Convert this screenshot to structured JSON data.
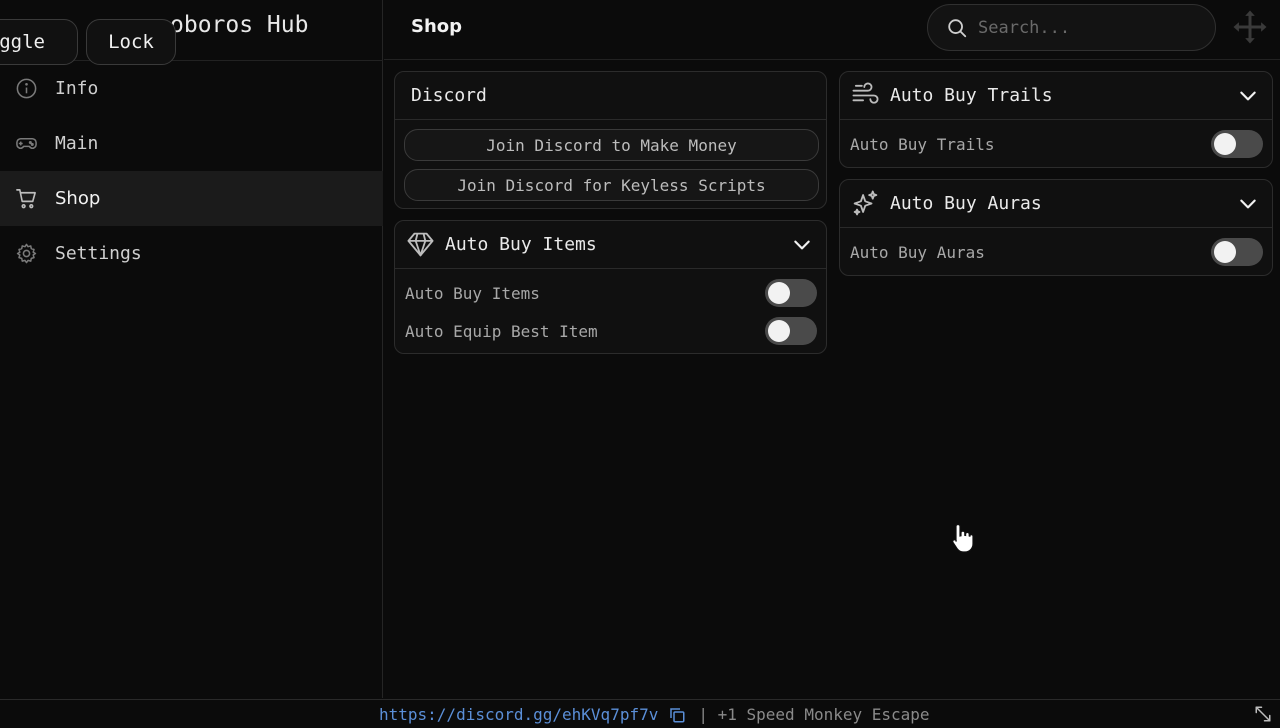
{
  "sidebar": {
    "hub_title": "oboros Hub",
    "toggle_label": "ggle",
    "lock_label": "Lock",
    "items": [
      {
        "label": "Info",
        "icon": "info-icon"
      },
      {
        "label": "Main",
        "icon": "gamepad-icon"
      },
      {
        "label": "Shop",
        "icon": "cart-icon",
        "active": true
      },
      {
        "label": "Settings",
        "icon": "gear-icon"
      }
    ]
  },
  "header": {
    "title": "Shop",
    "search_placeholder": "Search..."
  },
  "discord": {
    "title": "Discord",
    "button_money": "Join Discord to Make Money",
    "button_keyless": "Join Discord for Keyless Scripts"
  },
  "items": {
    "title": "Auto Buy Items",
    "toggles": [
      {
        "label": "Auto Buy Items",
        "on": false
      },
      {
        "label": "Auto Equip Best Item",
        "on": false
      }
    ]
  },
  "trails": {
    "title": "Auto Buy Trails",
    "toggles": [
      {
        "label": "Auto Buy Trails",
        "on": false
      }
    ]
  },
  "auras": {
    "title": "Auto Buy Auras",
    "toggles": [
      {
        "label": "Auto Buy Auras",
        "on": false
      }
    ]
  },
  "footer": {
    "link": "https://discord.gg/ehKVq7pf7v",
    "info": "| +1 Speed Monkey Escape"
  },
  "colors": {
    "background": "#0b0b0b",
    "active_nav": "#1b1b1b",
    "link": "#5b8fd8",
    "toggle_off": "#4a4a4a"
  }
}
